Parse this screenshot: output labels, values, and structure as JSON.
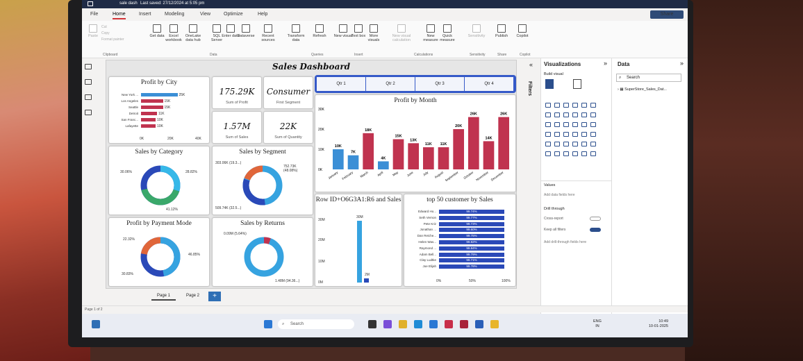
{
  "window": {
    "title": "sale dash",
    "saved": "Last saved: 27/12/2024 at 5:05 pm"
  },
  "menu": [
    "File",
    "Home",
    "Insert",
    "Modeling",
    "View",
    "Optimize",
    "Help"
  ],
  "share": "Share",
  "ribbon": {
    "buttons": [
      {
        "label": "Paste",
        "dim": true
      },
      {
        "label": "Get data",
        "dim": false
      },
      {
        "label": "Excel workbook",
        "dim": false
      },
      {
        "label": "OneLake data hub",
        "dim": false
      },
      {
        "label": "SQL Server",
        "dim": false
      },
      {
        "label": "Enter data",
        "dim": false
      },
      {
        "label": "Dataverse",
        "dim": false
      },
      {
        "label": "Recent sources",
        "dim": false
      },
      {
        "label": "Transform data",
        "dim": false
      },
      {
        "label": "Refresh",
        "dim": false
      },
      {
        "label": "New visual",
        "dim": false
      },
      {
        "label": "Text box",
        "dim": false
      },
      {
        "label": "More visuals",
        "dim": false
      },
      {
        "label": "New visual calculation",
        "dim": true
      },
      {
        "label": "New measure",
        "dim": false
      },
      {
        "label": "Quick measure",
        "dim": false
      },
      {
        "label": "Sensitivity",
        "dim": true
      },
      {
        "label": "Publish",
        "dim": false
      },
      {
        "label": "Copilot",
        "dim": false
      }
    ],
    "clip": [
      "Cut",
      "Copy",
      "Format painter"
    ],
    "groups": [
      "Clipboard",
      "Data",
      "Queries",
      "Insert",
      "Calculations",
      "Sensitivity",
      "Share",
      "Copilot"
    ]
  },
  "dashboard": {
    "title": "Sales Dashboard",
    "profit_by_city": {
      "title": "Profit by City",
      "cities": [
        "New York ...",
        "Los Angeles",
        "Seattle",
        "Detroit",
        "San Franc...",
        "Lafayette"
      ],
      "values": [
        25,
        15,
        15,
        11,
        10,
        10
      ],
      "labels": [
        "25K",
        "15K",
        "15K",
        "11K",
        "10K",
        "10K"
      ],
      "axis": [
        "0K",
        "20K",
        "40K"
      ]
    },
    "kpis": [
      {
        "value": "175.29K",
        "label": "Sum of Profit"
      },
      {
        "value": "Consumer",
        "label": "First Segment"
      },
      {
        "value": "1.57M",
        "label": "Sum of Sales"
      },
      {
        "value": "22K",
        "label": "Sum of Quantity"
      }
    ],
    "slicer": [
      "Qtr 1",
      "Qtr 2",
      "Qtr 3",
      "Qtr 4"
    ],
    "profit_by_month": {
      "title": "Profit by Month"
    },
    "sales_by_category": {
      "title": "Sales by Category",
      "labels": [
        "30.06%",
        "28.82%",
        "41.12%"
      ]
    },
    "sales_by_segment": {
      "title": "Sales by Segment",
      "labels": [
        "303.06K (19.3...)",
        "752.73K (48.08%)",
        "509.74K (32.5...)"
      ]
    },
    "profit_by_payment": {
      "title": "Profit by Payment Mode",
      "labels": [
        "22.32%",
        "46.85%",
        "30.83%"
      ]
    },
    "sales_by_returns": {
      "title": "Sales by Returns",
      "labels": [
        "0.09M (5.64%)",
        "1.48M (94.36...)"
      ]
    },
    "row_id": {
      "title": "Row ID+O6G3A1:R6 and Sales",
      "axis": [
        "30M",
        "20M",
        "10M",
        "0M"
      ],
      "labels": [
        "30M",
        "2M"
      ]
    },
    "top50": {
      "title": "top 50 customer by Sales",
      "names": [
        "Edward Ho...",
        "Seth Vernon",
        "Pete Kriz",
        "Jonathan ...",
        "Dan Reiche...",
        "Helen Was...",
        "Raymond ...",
        "Adam Bell...",
        "Clay Ludtke",
        "Joe Elijah"
      ],
      "values": [
        "99.74%",
        "99.77%",
        "99.73%",
        "99.60%",
        "99.75%",
        "99.82%",
        "99.84%",
        "99.79%",
        "99.71%",
        "99.78%"
      ],
      "axis": [
        "0%",
        "50%",
        "100%"
      ]
    }
  },
  "chart_data": {
    "type": "bar",
    "title": "Profit by Month",
    "categories": [
      "January",
      "February",
      "March",
      "April",
      "May",
      "June",
      "July",
      "August",
      "September",
      "October",
      "November",
      "December"
    ],
    "values": [
      10,
      7,
      18,
      4,
      15,
      13,
      11,
      11,
      20,
      26,
      14,
      26
    ],
    "labels": [
      "10K",
      "7K",
      "18K",
      "4K",
      "15K",
      "13K",
      "11K",
      "11K",
      "20K",
      "26K",
      "14K",
      "26K"
    ],
    "yticks": [
      "30K",
      "20K",
      "10K",
      "0K"
    ],
    "ylim": [
      0,
      30
    ],
    "colors": [
      "#3b8fd6",
      "#3b8fd6",
      "#c0334f",
      "#3b8fd6",
      "#c0334f",
      "#c0334f",
      "#c0334f",
      "#c0334f",
      "#c0334f",
      "#c0334f",
      "#c0334f",
      "#c0334f"
    ]
  },
  "visualizations": {
    "title": "Visualizations",
    "build": "Build visual",
    "values": "Values",
    "add_data": "Add data fields here",
    "drill": "Drill through",
    "cross": "Cross-report",
    "off": "Off",
    "keep": "Keep all filters",
    "on": "On",
    "add_drill": "Add drill-through fields here"
  },
  "data_pane": {
    "title": "Data",
    "search": "Search",
    "table": "SuperStore_Sales_Dat..."
  },
  "filters": "Filters",
  "pages": [
    "Page 1",
    "Page 2"
  ],
  "status": "Page 1 of 2",
  "taskbar": {
    "search": "Search",
    "lang": "ENG",
    "region": "IN",
    "time": "10:49",
    "date": "10-01-2025"
  }
}
